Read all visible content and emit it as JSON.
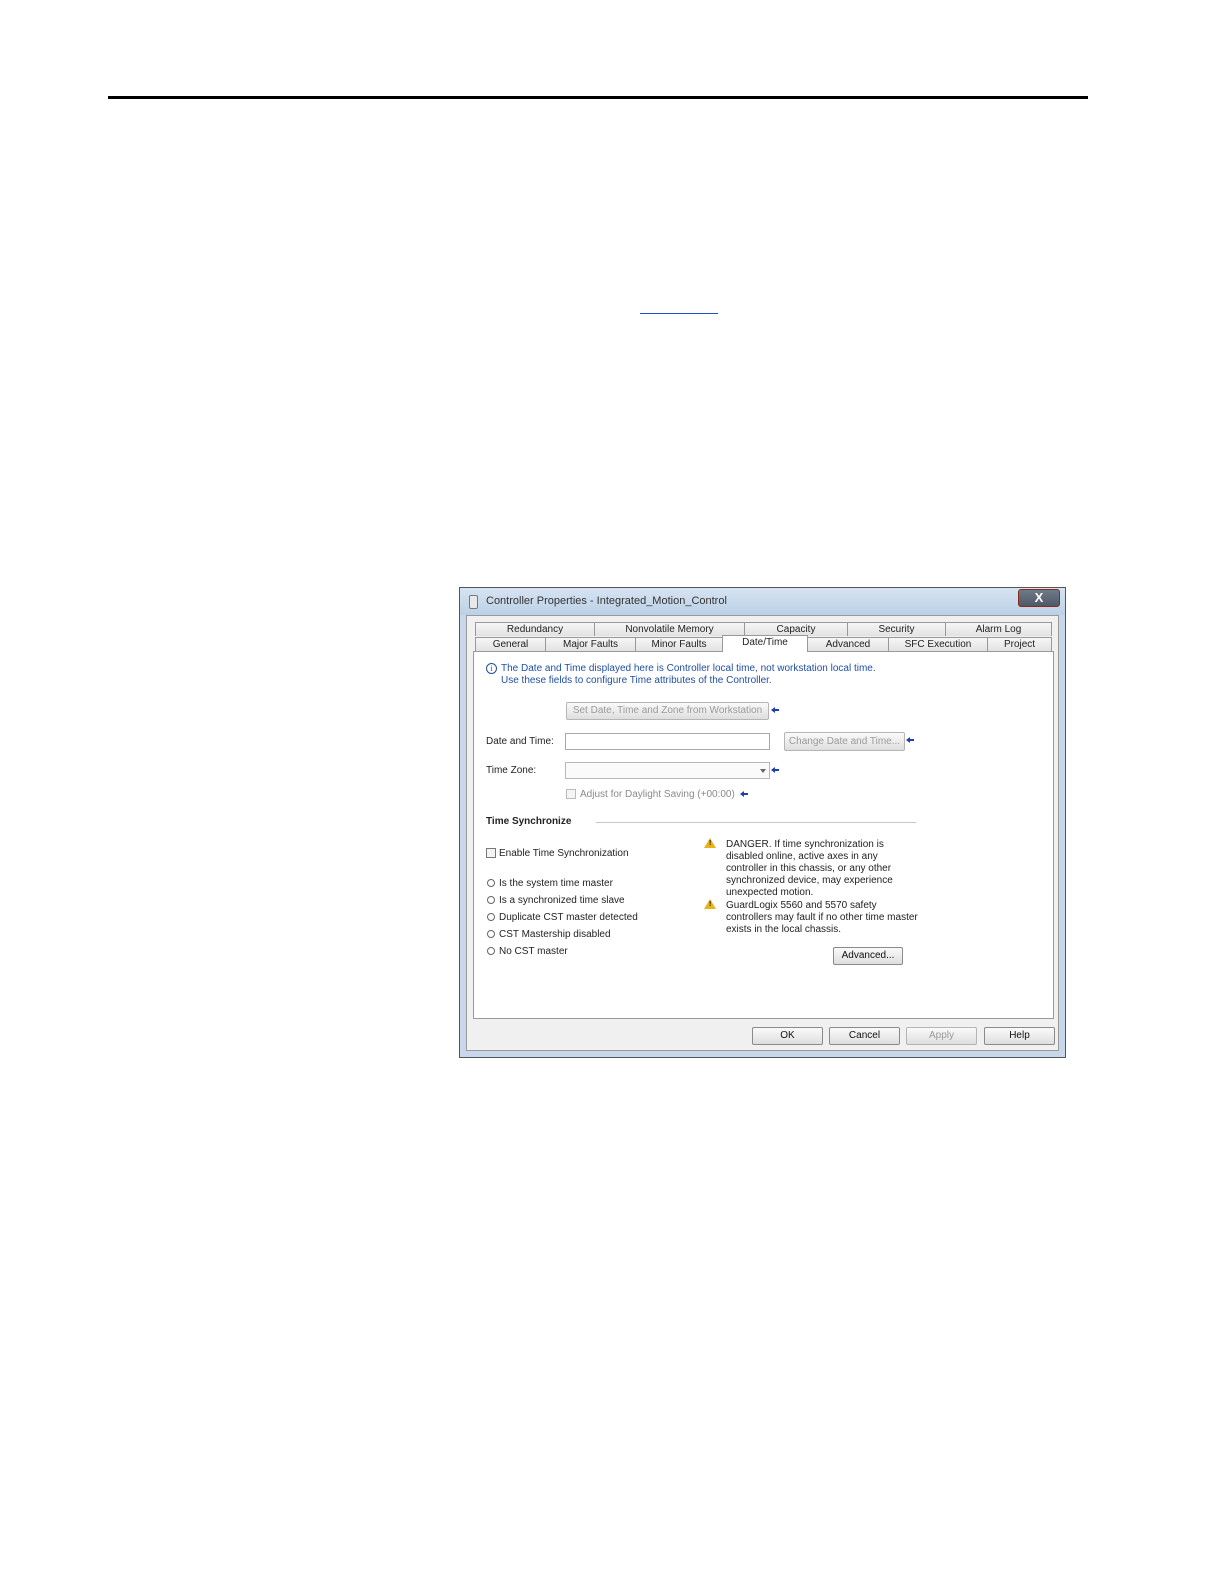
{
  "dialog": {
    "title": "Controller Properties - Integrated_Motion_Control",
    "close_label": "X",
    "tabs_top": [
      "Redundancy",
      "Nonvolatile Memory",
      "Capacity",
      "Security",
      "Alarm Log"
    ],
    "tabs_bottom": [
      "General",
      "Major Faults",
      "Minor Faults",
      "Date/Time",
      "Advanced",
      "SFC Execution",
      "Project"
    ],
    "active_tab": "Date/Time",
    "info_line1": "The Date and Time displayed here is Controller local time, not workstation local time.",
    "info_line2": "Use these fields to configure Time attributes of the Controller.",
    "set_from_workstation_label": "Set Date, Time and Zone from Workstation",
    "date_time_label": "Date and Time:",
    "date_time_value": "",
    "change_date_time_label": "Change Date and Time...",
    "time_zone_label": "Time Zone:",
    "time_zone_value": "",
    "daylight_saving_label": "Adjust for Daylight Saving (+00:00)",
    "time_sync_heading": "Time Synchronize",
    "enable_time_sync_label": "Enable Time Synchronization",
    "radio_options": [
      "Is the system time master",
      "Is a synchronized time slave",
      "Duplicate CST master detected",
      "CST Mastership disabled",
      "No CST master"
    ],
    "danger_text": "DANGER. If time synchronization is disabled online, active axes in any controller in this chassis, or any other synchronized device, may experience unexpected motion.",
    "guardlogix_text": "GuardLogix 5560 and 5570 safety controllers may fault if no other time master exists in the local chassis.",
    "advanced_button_label": "Advanced...",
    "footer_buttons": [
      "OK",
      "Cancel",
      "Apply",
      "Help"
    ]
  }
}
